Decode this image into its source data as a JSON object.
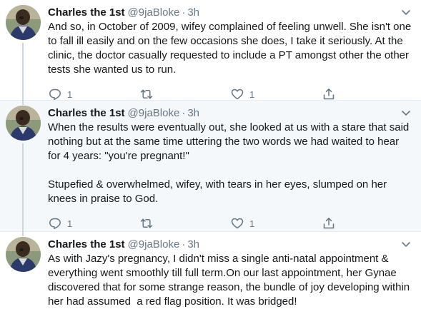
{
  "tweets": [
    {
      "name": "Charles the 1st",
      "handle": "@9jaBloke",
      "separator": "·",
      "time": "3h",
      "text": "And so, in October of 2009, wifey complained of feeling unwell. She isn't one to fall ill easily and on the few occasions she does, I take it seriously. At the clinic, the doctor casually requested to include a PT amongst other the other tests she wanted us to run.",
      "reply_count": "1",
      "retweet_count": "",
      "like_count": "1"
    },
    {
      "name": "Charles the 1st",
      "handle": "@9jaBloke",
      "separator": "·",
      "time": "3h",
      "text": "When the results were eventually out, she looked at us with a stare that said nothing but at the same time uttering the two words we had waited to hear for 4 years: \"you're pregnant!\"\n\nStupefied & overwhelmed, wifey, with tears in her eyes, slumped on her knees in praise to God.",
      "reply_count": "1",
      "retweet_count": "",
      "like_count": "1"
    },
    {
      "name": "Charles the 1st",
      "handle": "@9jaBloke",
      "separator": "·",
      "time": "3h",
      "text": "As with Jazy's pregnancy, I didn't miss a single anti-natal appointment & everything went smoothly till full term.On our last appointment, her Gynae discovered that for some strange reason, the bundle of joy developing within her had assumed  a red flag position. It was bridged!"
    }
  ],
  "icons": {
    "more": "chevron-down-icon",
    "reply": "reply-icon",
    "retweet": "retweet-icon",
    "like": "heart-icon",
    "share": "share-icon"
  },
  "colors": {
    "text": "#14171a",
    "muted": "#657786",
    "highlight_bg": "#f5f8fa",
    "border": "#e6ecf0"
  }
}
